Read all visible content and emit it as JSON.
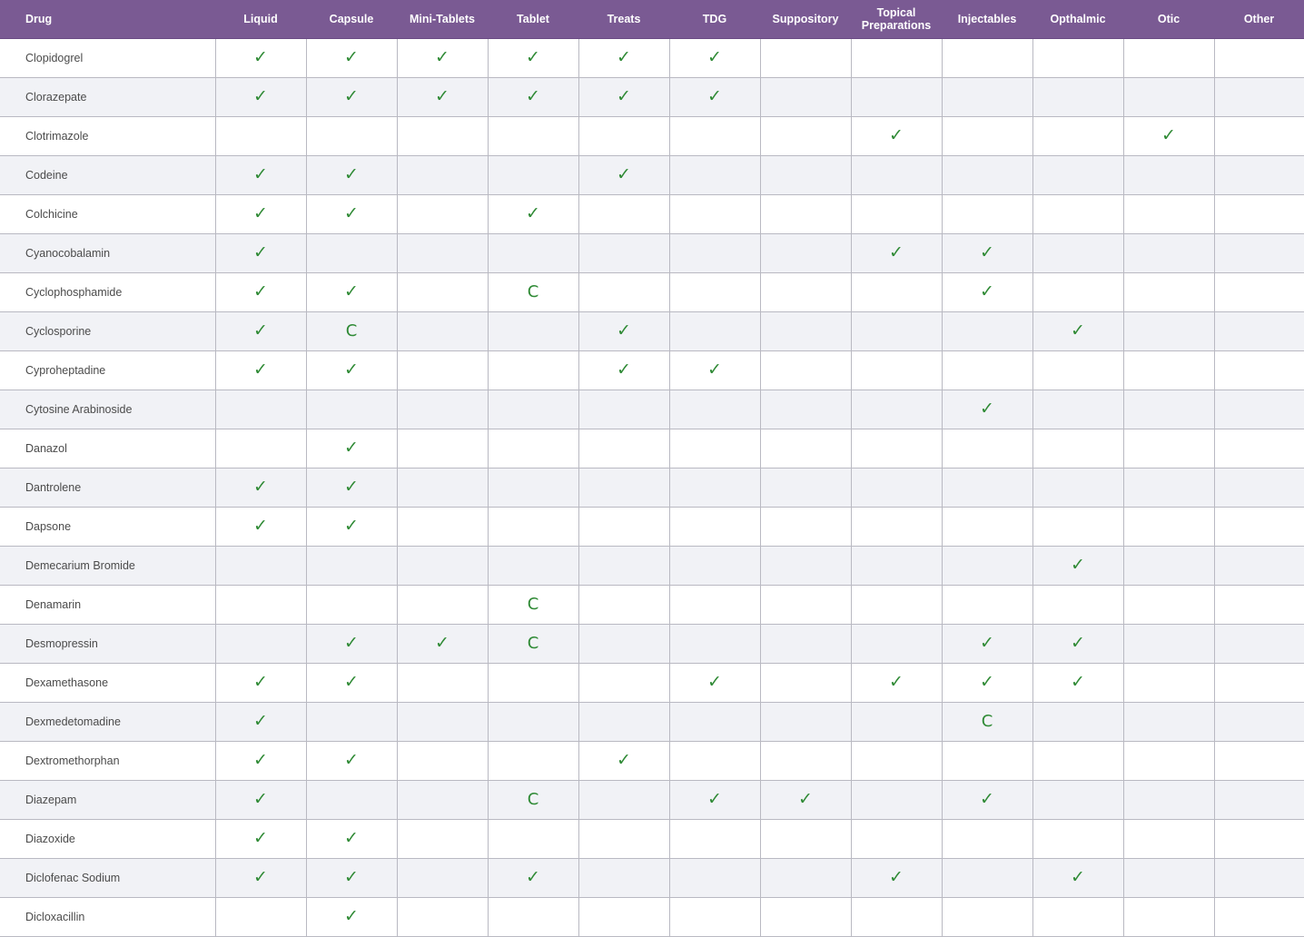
{
  "table": {
    "headers": [
      "Drug",
      "Liquid",
      "Capsule",
      "Mini-Tablets",
      "Tablet",
      "Treats",
      "TDG",
      "Suppository",
      "Topical Preparations",
      "Injectables",
      "Opthalmic",
      "Otic",
      "Other"
    ],
    "mark_symbols": {
      "check": "✓",
      "C": "C"
    },
    "colors": {
      "header_bg": "#7a5a93",
      "check": "#2f8a35",
      "row_alt": "#f1f2f6",
      "border": "#b9b9c2"
    },
    "rows": [
      {
        "drug": "Clopidogrel",
        "marks": [
          "check",
          "check",
          "check",
          "check",
          "check",
          "check",
          "",
          "",
          "",
          "",
          "",
          ""
        ]
      },
      {
        "drug": "Clorazepate",
        "marks": [
          "check",
          "check",
          "check",
          "check",
          "check",
          "check",
          "",
          "",
          "",
          "",
          "",
          ""
        ]
      },
      {
        "drug": "Clotrimazole",
        "marks": [
          "",
          "",
          "",
          "",
          "",
          "",
          "",
          "check",
          "",
          "",
          "check",
          ""
        ]
      },
      {
        "drug": "Codeine",
        "marks": [
          "check",
          "check",
          "",
          "",
          "check",
          "",
          "",
          "",
          "",
          "",
          "",
          ""
        ]
      },
      {
        "drug": "Colchicine",
        "marks": [
          "check",
          "check",
          "",
          "check",
          "",
          "",
          "",
          "",
          "",
          "",
          "",
          ""
        ]
      },
      {
        "drug": "Cyanocobalamin",
        "marks": [
          "check",
          "",
          "",
          "",
          "",
          "",
          "",
          "check",
          "check",
          "",
          "",
          ""
        ]
      },
      {
        "drug": "Cyclophosphamide",
        "marks": [
          "check",
          "check",
          "",
          "C",
          "",
          "",
          "",
          "",
          "check",
          "",
          "",
          ""
        ]
      },
      {
        "drug": "Cyclosporine",
        "marks": [
          "check",
          "C",
          "",
          "",
          "check",
          "",
          "",
          "",
          "",
          "check",
          "",
          ""
        ]
      },
      {
        "drug": "Cyproheptadine",
        "marks": [
          "check",
          "check",
          "",
          "",
          "check",
          "check",
          "",
          "",
          "",
          "",
          "",
          ""
        ]
      },
      {
        "drug": "Cytosine Arabinoside",
        "marks": [
          "",
          "",
          "",
          "",
          "",
          "",
          "",
          "",
          "check",
          "",
          "",
          ""
        ]
      },
      {
        "drug": "Danazol",
        "marks": [
          "",
          "check",
          "",
          "",
          "",
          "",
          "",
          "",
          "",
          "",
          "",
          ""
        ]
      },
      {
        "drug": "Dantrolene",
        "marks": [
          "check",
          "check",
          "",
          "",
          "",
          "",
          "",
          "",
          "",
          "",
          "",
          ""
        ]
      },
      {
        "drug": "Dapsone",
        "marks": [
          "check",
          "check",
          "",
          "",
          "",
          "",
          "",
          "",
          "",
          "",
          "",
          ""
        ]
      },
      {
        "drug": "Demecarium Bromide",
        "marks": [
          "",
          "",
          "",
          "",
          "",
          "",
          "",
          "",
          "",
          "check",
          "",
          ""
        ]
      },
      {
        "drug": "Denamarin",
        "marks": [
          "",
          "",
          "",
          "C",
          "",
          "",
          "",
          "",
          "",
          "",
          "",
          ""
        ]
      },
      {
        "drug": "Desmopressin",
        "marks": [
          "",
          "check",
          "check",
          "C",
          "",
          "",
          "",
          "",
          "check",
          "check",
          "",
          ""
        ]
      },
      {
        "drug": "Dexamethasone",
        "marks": [
          "check",
          "check",
          "",
          "",
          "",
          "check",
          "",
          "check",
          "check",
          "check",
          "",
          ""
        ]
      },
      {
        "drug": "Dexmedetomadine",
        "marks": [
          "check",
          "",
          "",
          "",
          "",
          "",
          "",
          "",
          "C",
          "",
          "",
          ""
        ]
      },
      {
        "drug": "Dextromethorphan",
        "marks": [
          "check",
          "check",
          "",
          "",
          "check",
          "",
          "",
          "",
          "",
          "",
          "",
          ""
        ]
      },
      {
        "drug": "Diazepam",
        "marks": [
          "check",
          "",
          "",
          "C",
          "",
          "check",
          "check",
          "",
          "check",
          "",
          "",
          ""
        ]
      },
      {
        "drug": "Diazoxide",
        "marks": [
          "check",
          "check",
          "",
          "",
          "",
          "",
          "",
          "",
          "",
          "",
          "",
          ""
        ]
      },
      {
        "drug": "Diclofenac Sodium",
        "marks": [
          "check",
          "check",
          "",
          "check",
          "",
          "",
          "",
          "check",
          "",
          "check",
          "",
          ""
        ]
      },
      {
        "drug": "Dicloxacillin",
        "marks": [
          "",
          "check",
          "",
          "",
          "",
          "",
          "",
          "",
          "",
          "",
          "",
          ""
        ]
      }
    ]
  }
}
